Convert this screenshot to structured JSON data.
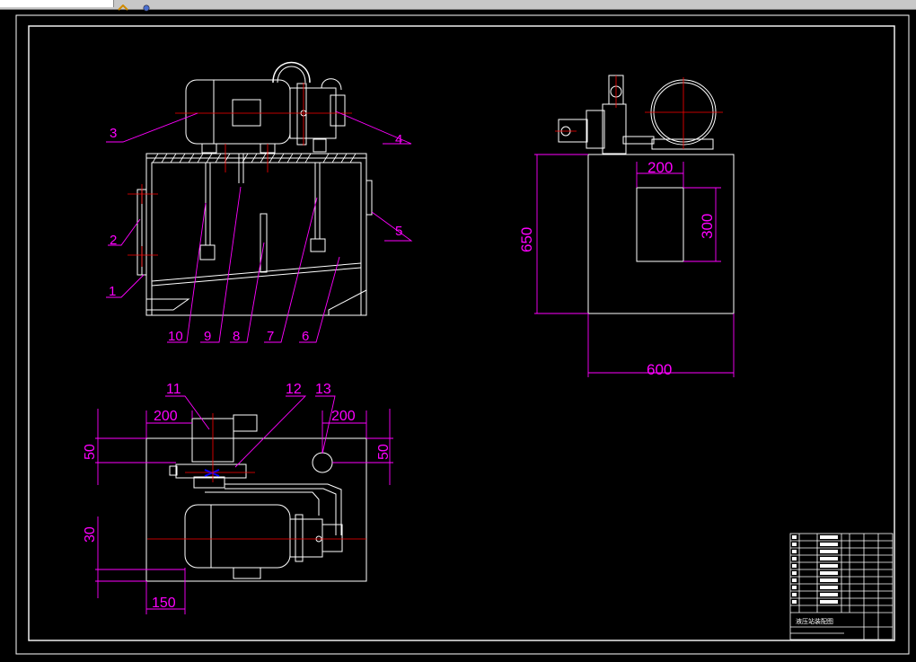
{
  "colors": {
    "background": "#000000",
    "frame": "#ffffff",
    "dimension": "#ff00ff",
    "centerline": "#ff0000",
    "accent": "#0000ff",
    "toolbar": "#c8c8c8"
  },
  "toolbar": {
    "icons": [
      "pan-icon",
      "settings-icon"
    ]
  },
  "front_view": {
    "leaders": [
      "1",
      "2",
      "3",
      "4",
      "5",
      "6",
      "7",
      "8",
      "9",
      "10"
    ]
  },
  "side_view": {
    "dims": {
      "height": "650",
      "width": "600",
      "window_width": "200",
      "window_height": "300"
    }
  },
  "top_view": {
    "leaders": [
      "11",
      "12",
      "13"
    ],
    "dims": {
      "left_offset": "200",
      "right_offset": "200",
      "left_depth": "50",
      "right_depth": "50",
      "motor_offset": "30",
      "motor_left": "150"
    }
  },
  "title_block": {
    "title": "液压站装配图"
  }
}
